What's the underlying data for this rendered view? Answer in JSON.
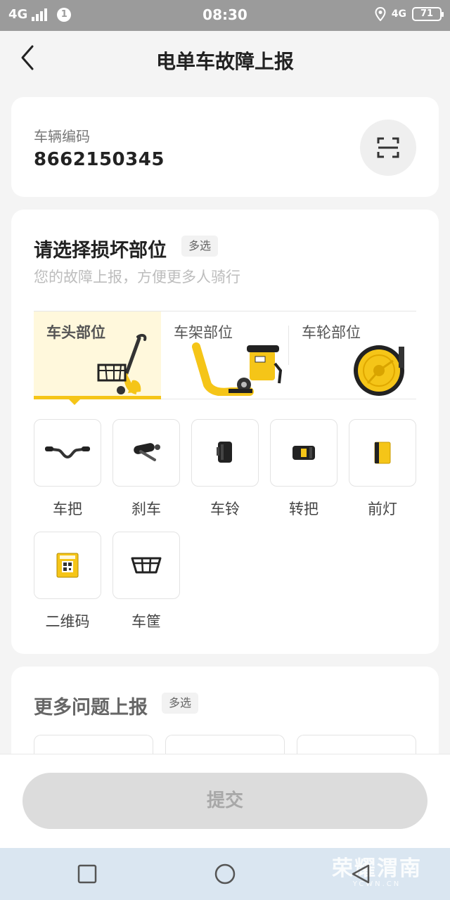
{
  "status_bar": {
    "network": "4G",
    "notification_count": "1",
    "time": "08:30",
    "network_right": "4G",
    "battery": "71"
  },
  "header": {
    "title": "电单车故障上报"
  },
  "vehicle": {
    "label": "车辆编码",
    "code": "8662150345"
  },
  "parts_section": {
    "title": "请选择损坏部位",
    "badge": "多选",
    "subtitle": "您的故障上报，方便更多人骑行",
    "tabs": [
      {
        "label": "车头部位",
        "active": true
      },
      {
        "label": "车架部位",
        "active": false
      },
      {
        "label": "车轮部位",
        "active": false
      }
    ],
    "parts": [
      {
        "label": "车把",
        "icon": "handlebar-icon"
      },
      {
        "label": "刹车",
        "icon": "brake-icon"
      },
      {
        "label": "车铃",
        "icon": "bell-icon"
      },
      {
        "label": "转把",
        "icon": "throttle-icon"
      },
      {
        "label": "前灯",
        "icon": "headlight-icon"
      },
      {
        "label": "二维码",
        "icon": "qr-code-icon"
      },
      {
        "label": "车筐",
        "icon": "basket-icon"
      }
    ]
  },
  "more_section": {
    "title": "更多问题上报",
    "badge": "多选"
  },
  "footer": {
    "submit_label": "提交"
  },
  "watermark": {
    "main": "荣耀渭南",
    "sub": "YCWN.CN"
  },
  "colors": {
    "accent_yellow": "#f5c518",
    "active_tab_bg": "#fff8dc",
    "disabled_button": "#dcdcdc"
  }
}
